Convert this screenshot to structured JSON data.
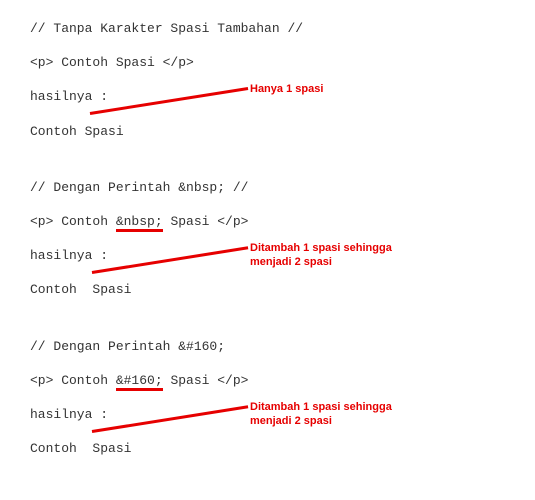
{
  "blocks": [
    {
      "comment": "// Tanpa Karakter Spasi Tambahan //",
      "code_prefix": "<p> Contoh Spasi </p>",
      "code_entity": "",
      "code_suffix": "",
      "result_label": "hasilnya :",
      "result_output_prefix": "Contoh",
      "result_output_gap": " ",
      "result_output_suffix": "Spasi",
      "annotation": "Hanya 1 spasi"
    },
    {
      "comment": "// Dengan Perintah &nbsp; //",
      "code_prefix": "<p> Contoh ",
      "code_entity": "&nbsp;",
      "code_suffix": " Spasi </p>",
      "result_label": "hasilnya :",
      "result_output_prefix": "Contoh",
      "result_output_gap": "  ",
      "result_output_suffix": "Spasi",
      "annotation": "Ditambah 1 spasi sehingga menjadi 2 spasi"
    },
    {
      "comment": "// Dengan Perintah &#160;",
      "code_prefix": "<p> Contoh ",
      "code_entity": "&#160;",
      "code_suffix": " Spasi </p>",
      "result_label": "hasilnya :",
      "result_output_prefix": "Contoh",
      "result_output_gap": "  ",
      "result_output_suffix": "Spasi",
      "annotation": "Ditambah 1 spasi sehingga menjadi 2 spasi"
    }
  ]
}
